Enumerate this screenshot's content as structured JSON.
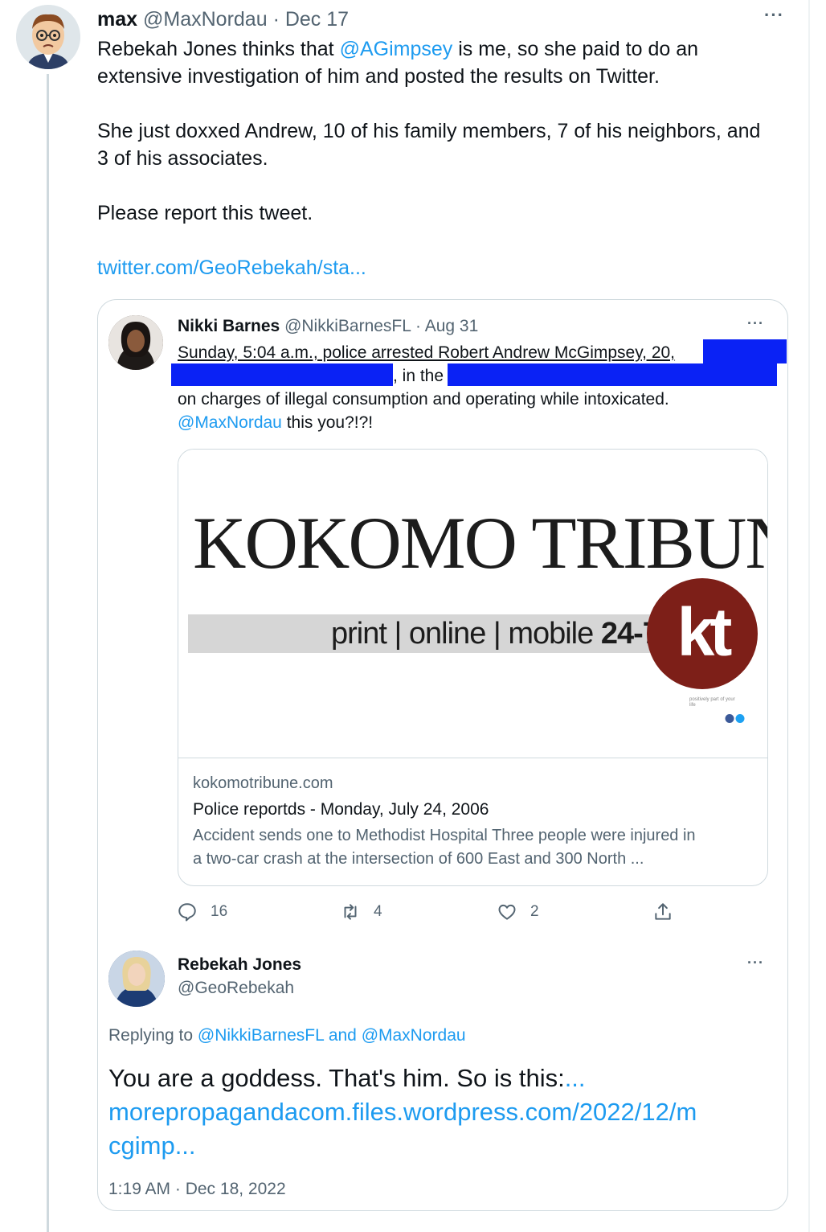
{
  "main_tweet": {
    "display_name": "max",
    "handle": "@MaxNordau",
    "separator": "·",
    "date": "Dec 17",
    "more": "···",
    "line1_pre": "Rebekah Jones thinks that ",
    "line1_mention": "@AGimpsey",
    "line1_post": " is me, so she paid to do an",
    "line2": "extensive investigation of him and posted the results on Twitter.",
    "para2_line1": "She just doxxed Andrew, 10 of his family members, 7 of his neighbors, and",
    "para2_line2": "3 of his associates.",
    "para3": "Please report this tweet.",
    "link": "twitter.com/GeoRebekah/sta..."
  },
  "quoted_tweet": {
    "display_name": "Nikki Barnes",
    "handle": "@NikkiBarnesFL",
    "separator": "·",
    "date": "Aug 31",
    "more": "···",
    "line1": "Sunday, 5:04 a.m., police arrested Robert Andrew McGimpsey, 20,",
    "line2_mid": ", in the",
    "line3": "on charges of illegal consumption and operating while intoxicated.",
    "line4_mention": "@MaxNordau",
    "line4_post": " this you?!?!",
    "redaction_color": "#0a22f5",
    "link_card": {
      "logo_title": "KOKOMO TRIBUNE",
      "logo_tagline": "print | online | mobile",
      "logo_tagline_bold": "24-7",
      "logo_badge": "kt",
      "logo_small": "positively part of your life",
      "logo_color": "#7d1f18",
      "domain": "kokomotribune.com",
      "title": "Police reportds - Monday, July 24, 2006",
      "description_line1": "Accident sends one to Methodist Hospital Three people were injured in",
      "description_line2": "a two-car crash at the intersection of 600 East and 300 North ..."
    },
    "actions": {
      "replies": "16",
      "retweets": "4",
      "likes": "2"
    }
  },
  "reply_tweet": {
    "display_name": "Rebekah Jones",
    "handle": "@GeoRebekah",
    "more": "···",
    "replying_prefix": "Replying to ",
    "replying_to": "@NikkiBarnesFL and @MaxNordau",
    "body_text": "You are a goddess. That's him. So is this:",
    "body_link_ellipsis": "...",
    "body_link_line1": "morepropagandacom.files.wordpress.com/2022/12/m",
    "body_link_line2": "cgimp...",
    "timestamp": "1:19 AM · Dec 18, 2022"
  },
  "colors": {
    "link": "#1d9bf0",
    "text": "#0f1419",
    "secondary": "#536471",
    "border": "#cfd9de"
  }
}
